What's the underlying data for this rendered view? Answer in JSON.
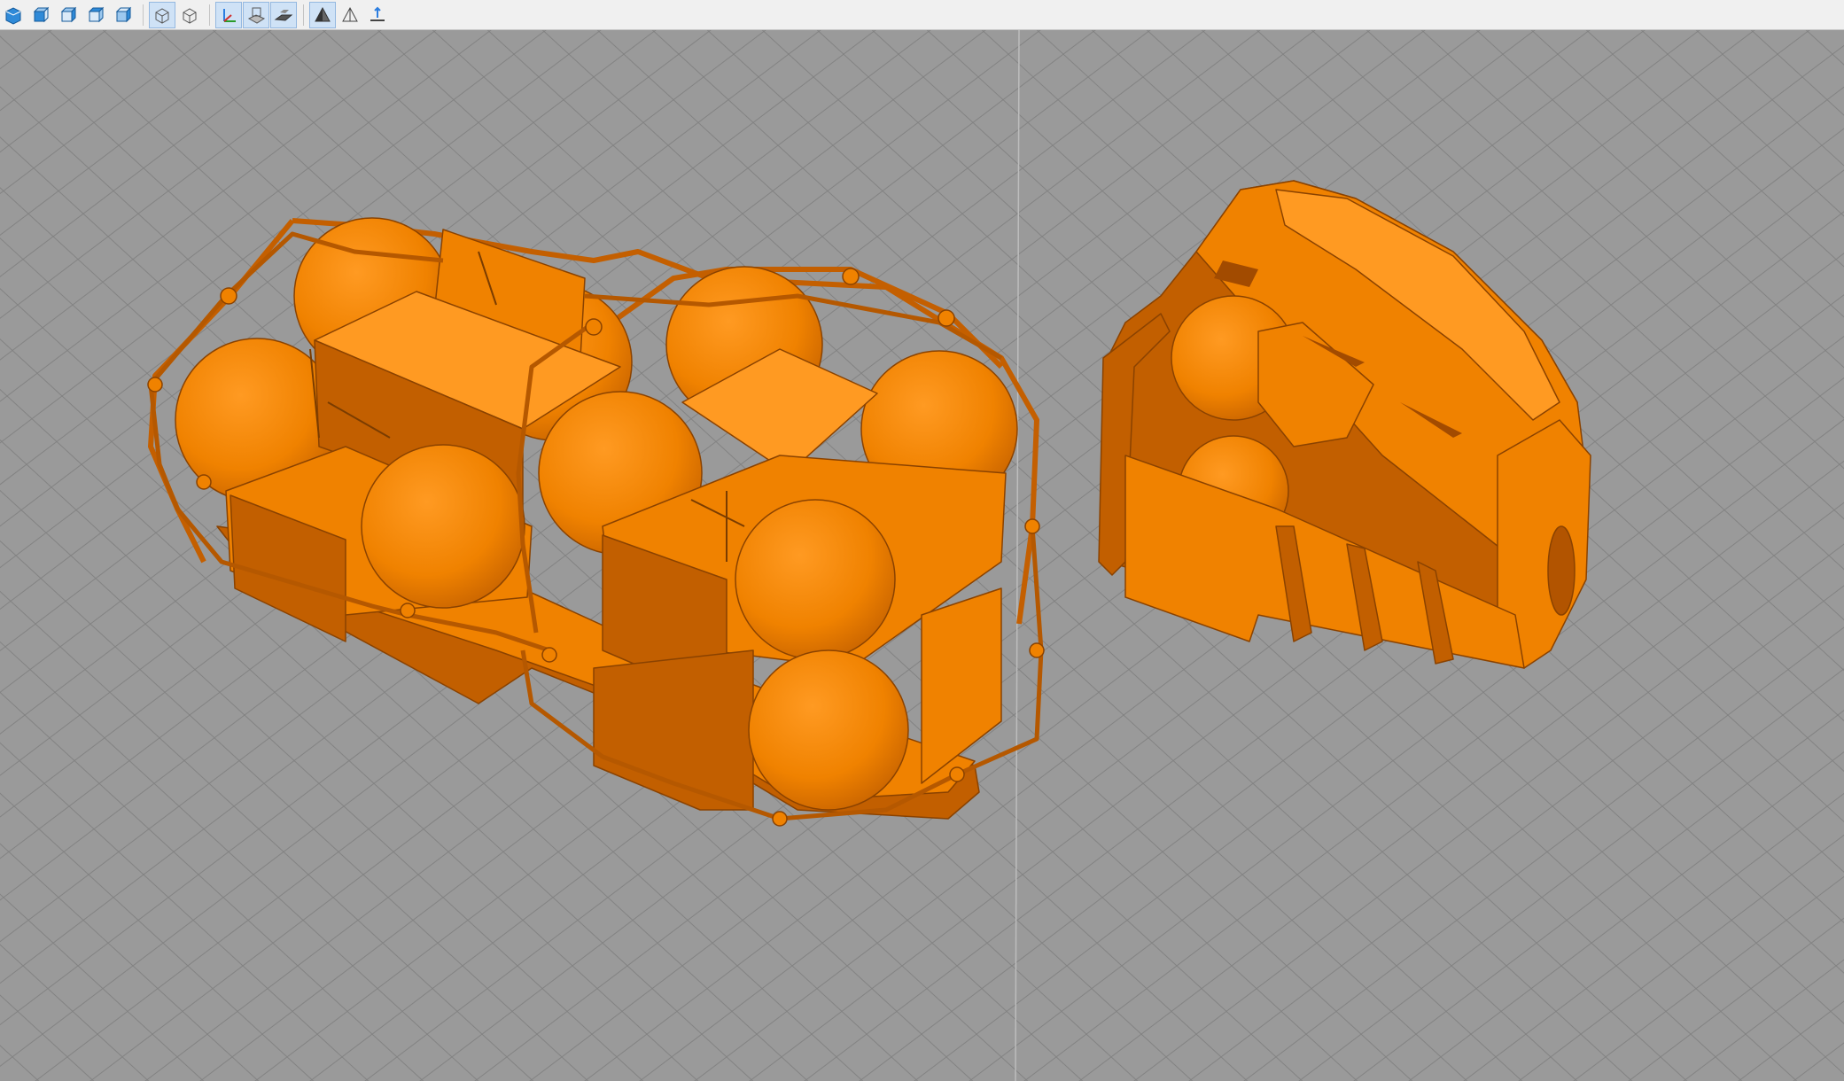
{
  "toolbar": {
    "groups": [
      [
        {
          "name": "view-perspective-icon",
          "active": false
        },
        {
          "name": "view-front-icon",
          "active": false
        },
        {
          "name": "view-left-icon",
          "active": false
        },
        {
          "name": "view-back-icon",
          "active": false
        },
        {
          "name": "view-right-icon",
          "active": false
        }
      ],
      [
        {
          "name": "wireframe-icon",
          "active": true
        },
        {
          "name": "bounding-box-icon",
          "active": false
        }
      ],
      [
        {
          "name": "axes-icon",
          "active": true
        },
        {
          "name": "grid-icon",
          "active": true
        },
        {
          "name": "build-plate-icon",
          "active": true
        }
      ],
      [
        {
          "name": "shaded-view-icon",
          "active": true
        },
        {
          "name": "outline-view-icon",
          "active": false
        },
        {
          "name": "ground-icon",
          "active": false
        }
      ]
    ]
  },
  "viewport": {
    "background_color": "#9a9a9a",
    "grid_color": "#838383",
    "model_color": "#f08200",
    "model_shadow_color": "#c25f00",
    "model_light_color": "#ff9a22",
    "objects": [
      {
        "name": "flotation-assembly-model"
      },
      {
        "name": "hull-housing-model"
      }
    ]
  }
}
